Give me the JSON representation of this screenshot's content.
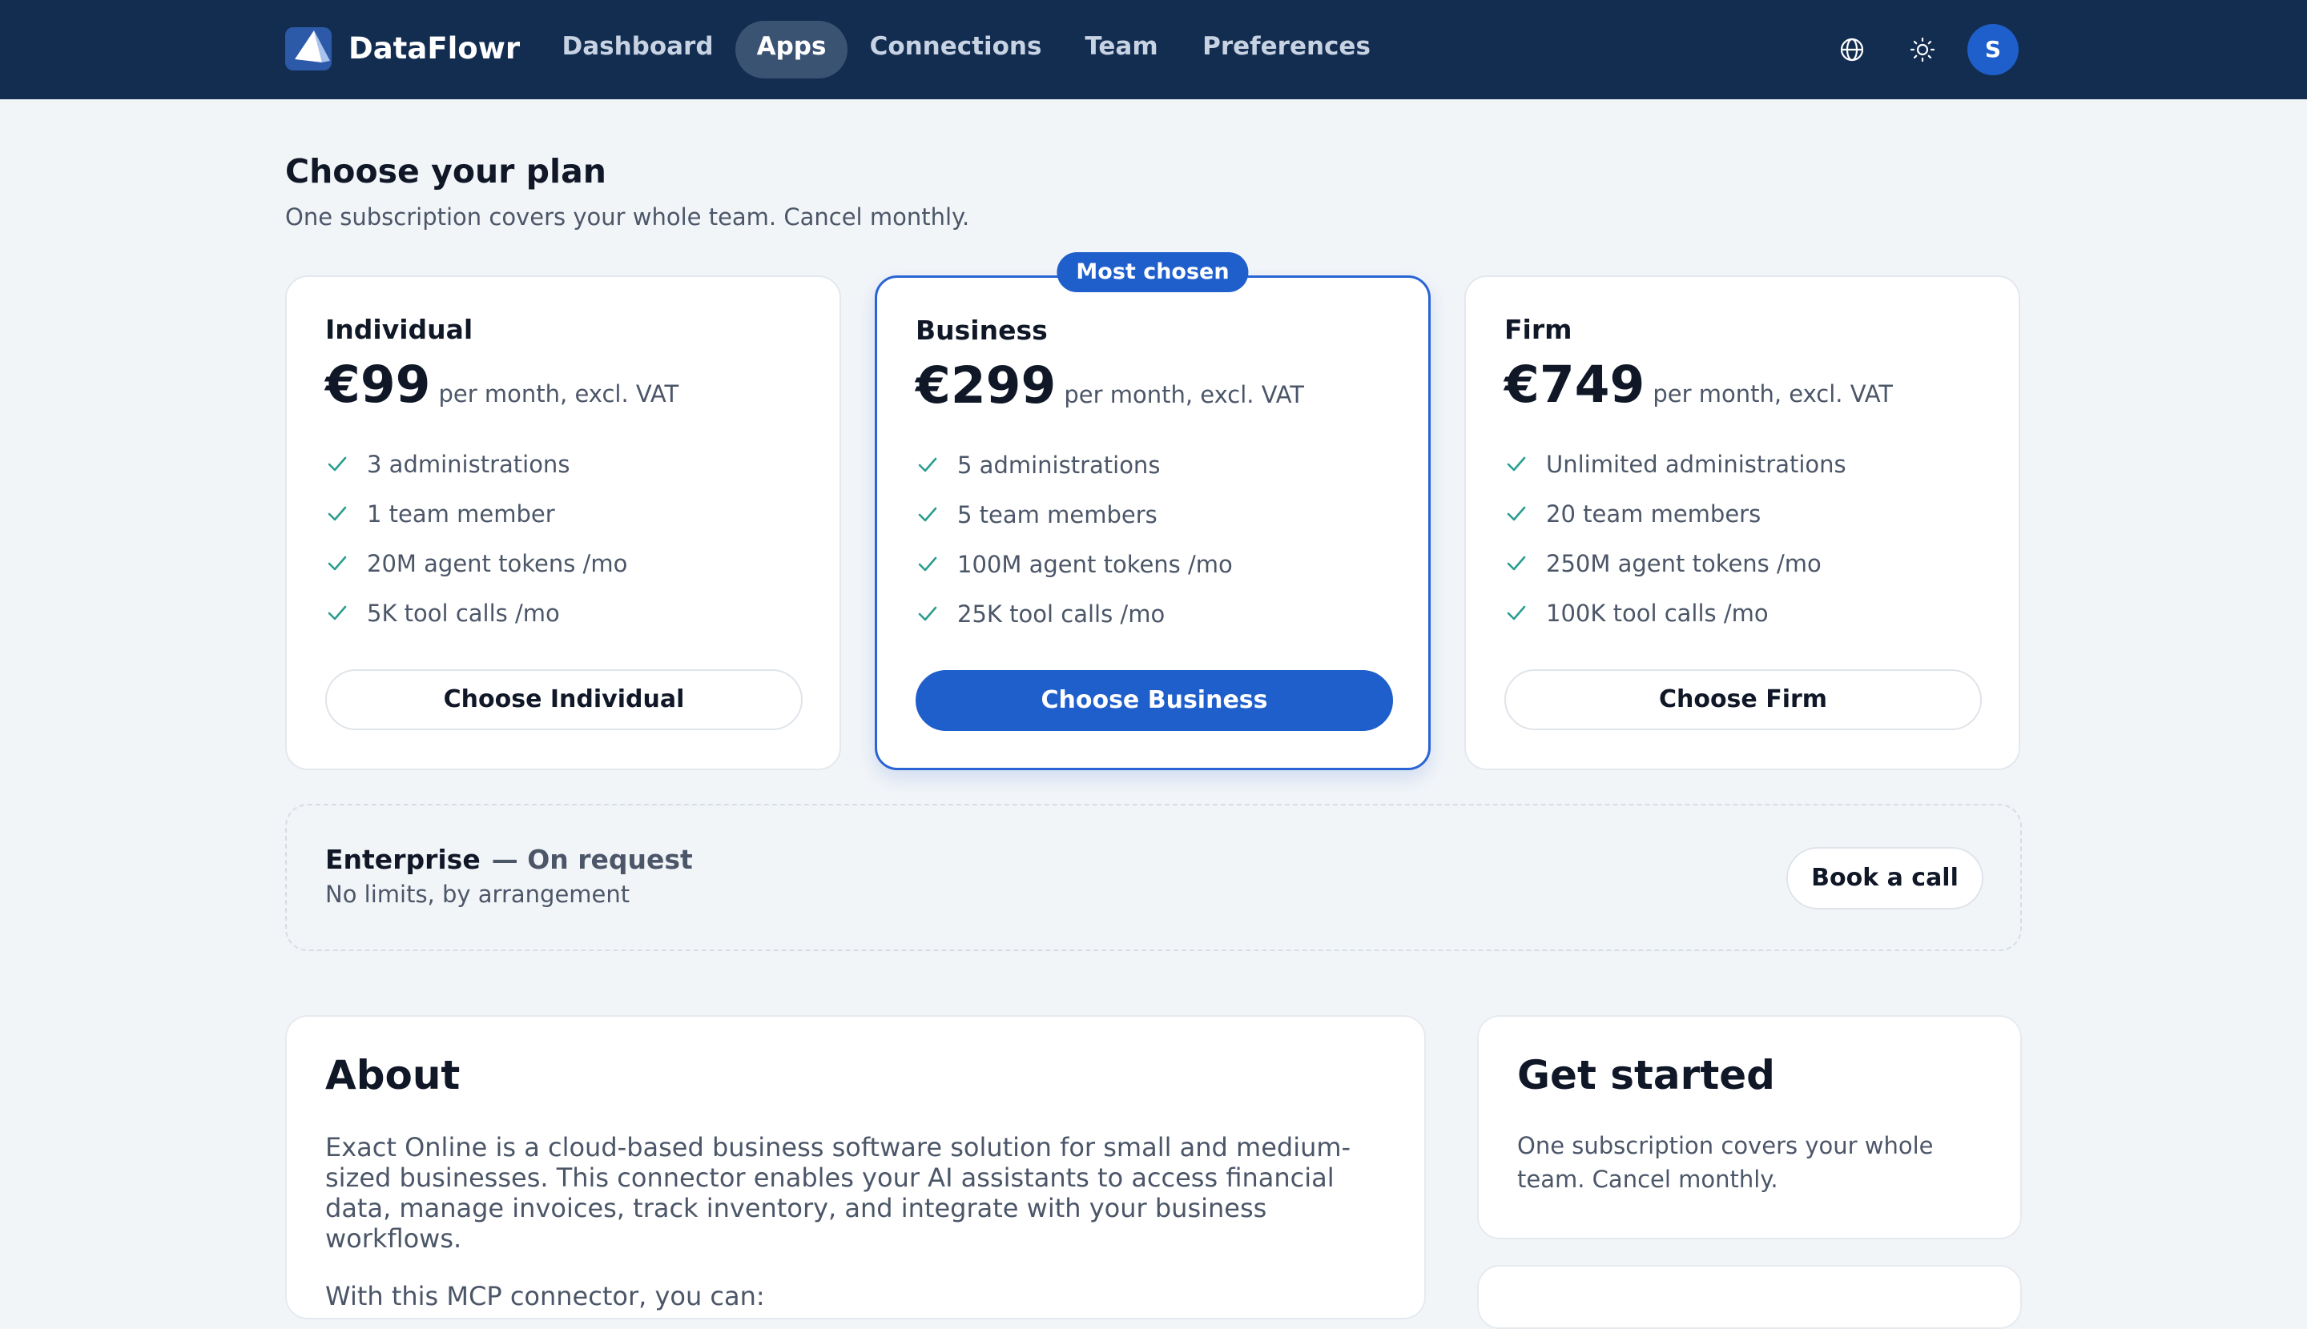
{
  "app": {
    "brand": "DataFlowr",
    "nav": [
      "Dashboard",
      "Apps",
      "Connections",
      "Team",
      "Preferences"
    ],
    "active_nav": "Apps",
    "avatar_initial": "S",
    "icons": [
      "globe-icon",
      "sun-icon"
    ]
  },
  "header": {
    "title": "Choose your plan",
    "subtitle": "One subscription covers your whole team. Cancel monthly."
  },
  "plans": [
    {
      "name": "Individual",
      "price": "€99",
      "period": "per month, excl. VAT",
      "features": [
        "3 administrations",
        "1 team member",
        "20M agent tokens /mo",
        "5K tool calls /mo"
      ],
      "cta": "Choose Individual"
    },
    {
      "name": "Business",
      "badge": "Most chosen",
      "price": "€299",
      "period": "per month, excl. VAT",
      "features": [
        "5 administrations",
        "5 team members",
        "100M agent tokens /mo",
        "25K tool calls /mo"
      ],
      "cta": "Choose Business"
    },
    {
      "name": "Firm",
      "price": "€749",
      "period": "per month, excl. VAT",
      "features": [
        "Unlimited administrations",
        "20 team members",
        "250M agent tokens /mo",
        "100K tool calls /mo"
      ],
      "cta": "Choose Firm"
    }
  ],
  "enterprise": {
    "name": "Enterprise",
    "request": "— On request",
    "subtitle": "No limits, by arrangement",
    "cta": "Book a call"
  },
  "about": {
    "title": "About",
    "text": "Exact Online is a cloud-based business software solution for small and medium-sized businesses. This connector enables your AI assistants to access financial data, manage invoices, track inventory, and integrate with your business workflows.",
    "text2": "With this MCP connector, you can:"
  },
  "get_started": {
    "title": "Get started",
    "text": "One subscription covers your whole team. Cancel monthly."
  },
  "colors": {
    "topbar": "#132d51",
    "accent": "#1f5fcb",
    "check": "#2a9d8f",
    "background": "#f2f5f8"
  }
}
